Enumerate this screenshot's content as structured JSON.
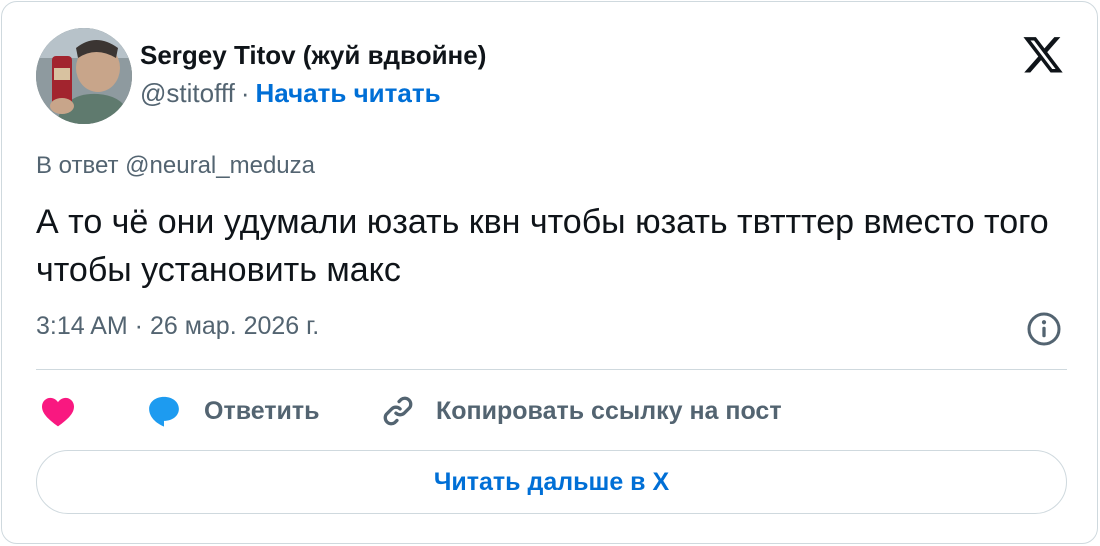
{
  "author": {
    "name": "Sergey Titov (жуй вдвойне)",
    "handle": "@stitofff",
    "separator": "·",
    "follow_label": "Начать читать"
  },
  "tweet": {
    "reply_to": "В ответ @neural_meduza",
    "text": "А то чё они удумали юзать квн чтобы юзать твтттер вместо того чтобы установить макс",
    "timestamp": "3:14 AM · 26 мар. 2026 г."
  },
  "actions": {
    "like_icon": "heart-icon",
    "reply_label": "Ответить",
    "copy_link_label": "Копировать ссылку на пост"
  },
  "read_more_label": "Читать дальше в X",
  "colors": {
    "accent": "#006fd6",
    "like": "#f91880",
    "reply": "#1d9bf0",
    "muted": "#536471",
    "border": "#cfd9de"
  }
}
